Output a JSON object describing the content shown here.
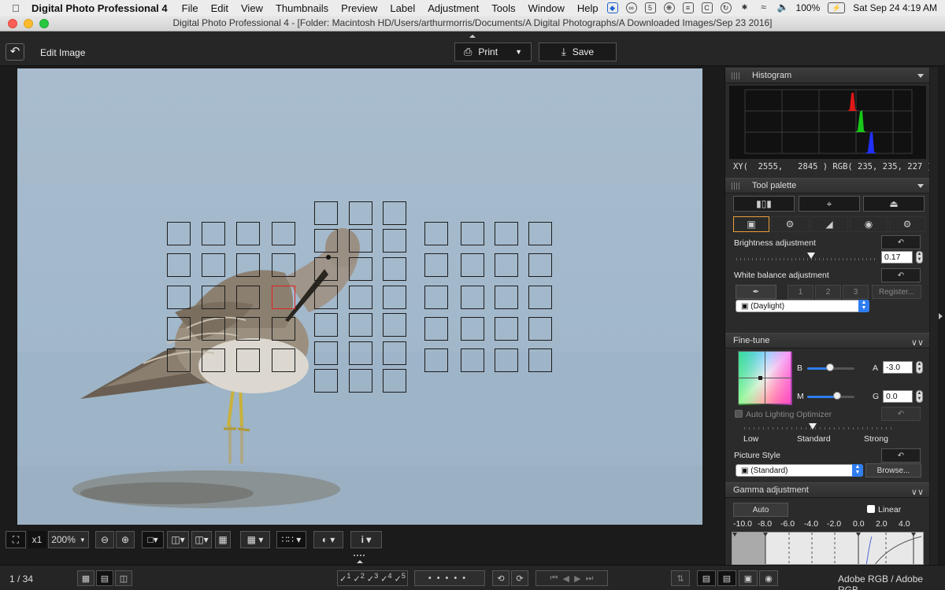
{
  "menubar": {
    "app_name": "Digital Photo Professional 4",
    "items": [
      "File",
      "Edit",
      "View",
      "Thumbnails",
      "Preview",
      "Label",
      "Adjustment",
      "Tools",
      "Window",
      "Help"
    ],
    "battery": "100%",
    "datetime": "Sat Sep 24  4:19 AM"
  },
  "window": {
    "title": "Digital Photo Professional 4 - [Folder: Macintosh HD/Users/arthurmorris/Documents/A Digital Photographs/A Downloaded Images/Sep 23 2016]"
  },
  "toolbar": {
    "edit_label": "Edit Image",
    "print_label": "Print",
    "save_label": "Save"
  },
  "view_toolbar": {
    "zoom_multiplier": "x1",
    "zoom_level": "200%"
  },
  "statusbar": {
    "page_counter": "1 / 34",
    "rating_labels": [
      "1",
      "2",
      "3",
      "4",
      "5"
    ],
    "color_space": "Adobe RGB / Adobe RGB"
  },
  "panel": {
    "histogram_title": "Histogram",
    "xy_readout": "XY(  2555,   2845 ) RGB( 235, 235, 227 )",
    "tool_palette_title": "Tool palette",
    "brightness": {
      "label": "Brightness adjustment",
      "value": "0.17",
      "level": 0.5
    },
    "white_balance": {
      "label": "White balance adjustment",
      "presets": [
        "1",
        "2",
        "3"
      ],
      "register_label": "Register...",
      "selected": "(Daylight)"
    },
    "fine_tune": {
      "title": "Fine-tune",
      "b_label": "B",
      "a_label": "A",
      "a_value": "-3.0",
      "m_label": "M",
      "g_label": "G",
      "g_value": "0.0"
    },
    "alo": {
      "label": "Auto Lighting Optimizer",
      "low": "Low",
      "standard": "Standard",
      "strong": "Strong"
    },
    "picture_style": {
      "label": "Picture Style",
      "selected": "(Standard)",
      "browse_label": "Browse..."
    },
    "gamma": {
      "title": "Gamma adjustment",
      "auto_label": "Auto",
      "linear_label": "Linear",
      "scale": [
        "-10.0",
        "-8.0",
        "-6.0",
        "-4.0",
        "-2.0",
        "0.0",
        "2.0",
        "4.0"
      ]
    }
  },
  "colors": {
    "accent_blue": "#2f7df0",
    "af_active": "#e02020",
    "active_tab": "#e8a03a"
  }
}
